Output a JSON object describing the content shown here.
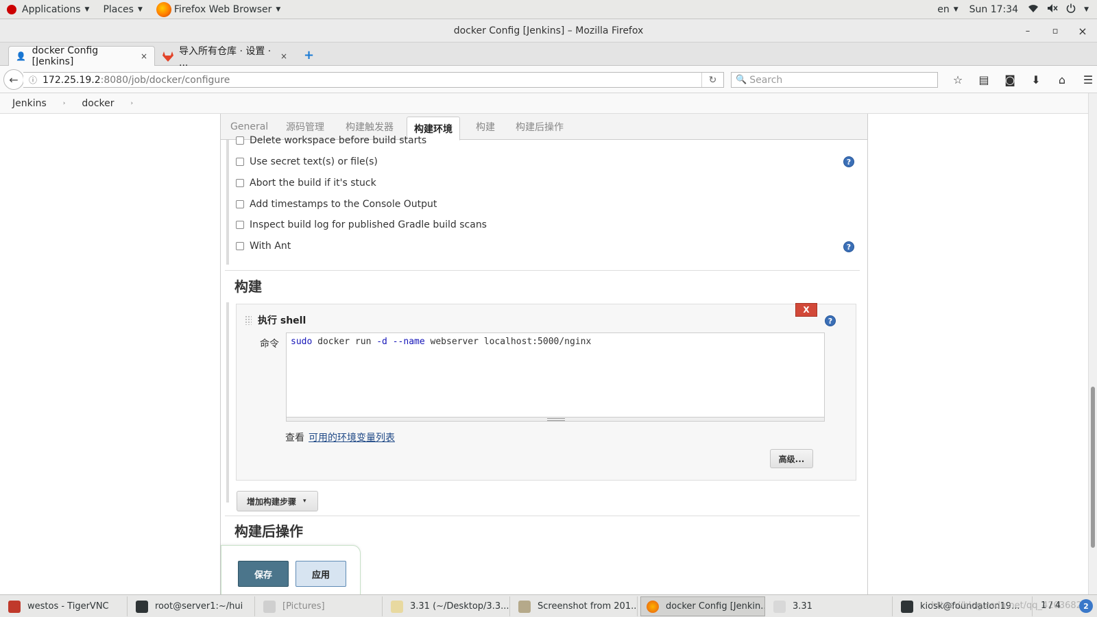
{
  "system_bar": {
    "applications": "Applications",
    "places": "Places",
    "active_app": "Firefox Web Browser",
    "lang": "en",
    "clock": "Sun 17:34"
  },
  "window": {
    "title": "docker Config [Jenkins] – Mozilla Firefox",
    "minimize": "–",
    "maximize": "▫",
    "close": "×"
  },
  "tabs": [
    {
      "label": "docker Config [Jenkins]",
      "close": "×"
    },
    {
      "label": "导入所有仓库 · 设置 · ...",
      "close": "×"
    }
  ],
  "new_tab": "+",
  "navbar": {
    "url_host": "172.25.19.2",
    "url_path": ":8080/job/docker/configure",
    "search_placeholder": "Search"
  },
  "breadcrumb": {
    "root": "Jenkins",
    "job": "docker",
    "separator": "›"
  },
  "config_tabs": [
    "General",
    "源码管理",
    "构建触发器",
    "构建环境",
    "构建",
    "构建后操作"
  ],
  "active_config_tab": "构建环境",
  "build_env_options": [
    "Delete workspace before build starts",
    "Use secret text(s) or file(s)",
    "Abort the build if it's stuck",
    "Add timestamps to the Console Output",
    "Inspect build log for published Gradle build scans",
    "With Ant"
  ],
  "help_glyph": "?",
  "build_section": {
    "title": "构建",
    "step_title": "执行 shell",
    "delete_label": "X",
    "command_label": "命令",
    "command": {
      "sudo": "sudo",
      "p1": " docker run ",
      "d": "-d",
      "sp": " ",
      "name": "--name",
      "p2": " webserver localhost:5000/nginx"
    },
    "env_prefix": "查看",
    "env_link": "可用的环境变量列表",
    "advanced": "高级...",
    "add_step": "增加构建步骤",
    "add_step_caret": "▾"
  },
  "post_build_title": "构建后操作",
  "footer_buttons": {
    "save": "保存",
    "apply": "应用"
  },
  "taskbar": {
    "items": [
      "westos - TigerVNC",
      "root@server1:~/hui",
      "[Pictures]",
      "3.31 (~/Desktop/3.3...",
      "Screenshot from 201...",
      "docker Config [Jenkin...",
      "3.31",
      "kiosk@foundation19..."
    ],
    "pager": "1 / 4",
    "watermark": "https://blog.csdn.net/qq_42036824",
    "notification_count": "2"
  },
  "colors": {
    "save_button": "#4b758b",
    "apply_button": "#d7e4f1",
    "delete_button": "#d24939",
    "help_icon": "#3b6fb6",
    "link": "#204a87"
  }
}
